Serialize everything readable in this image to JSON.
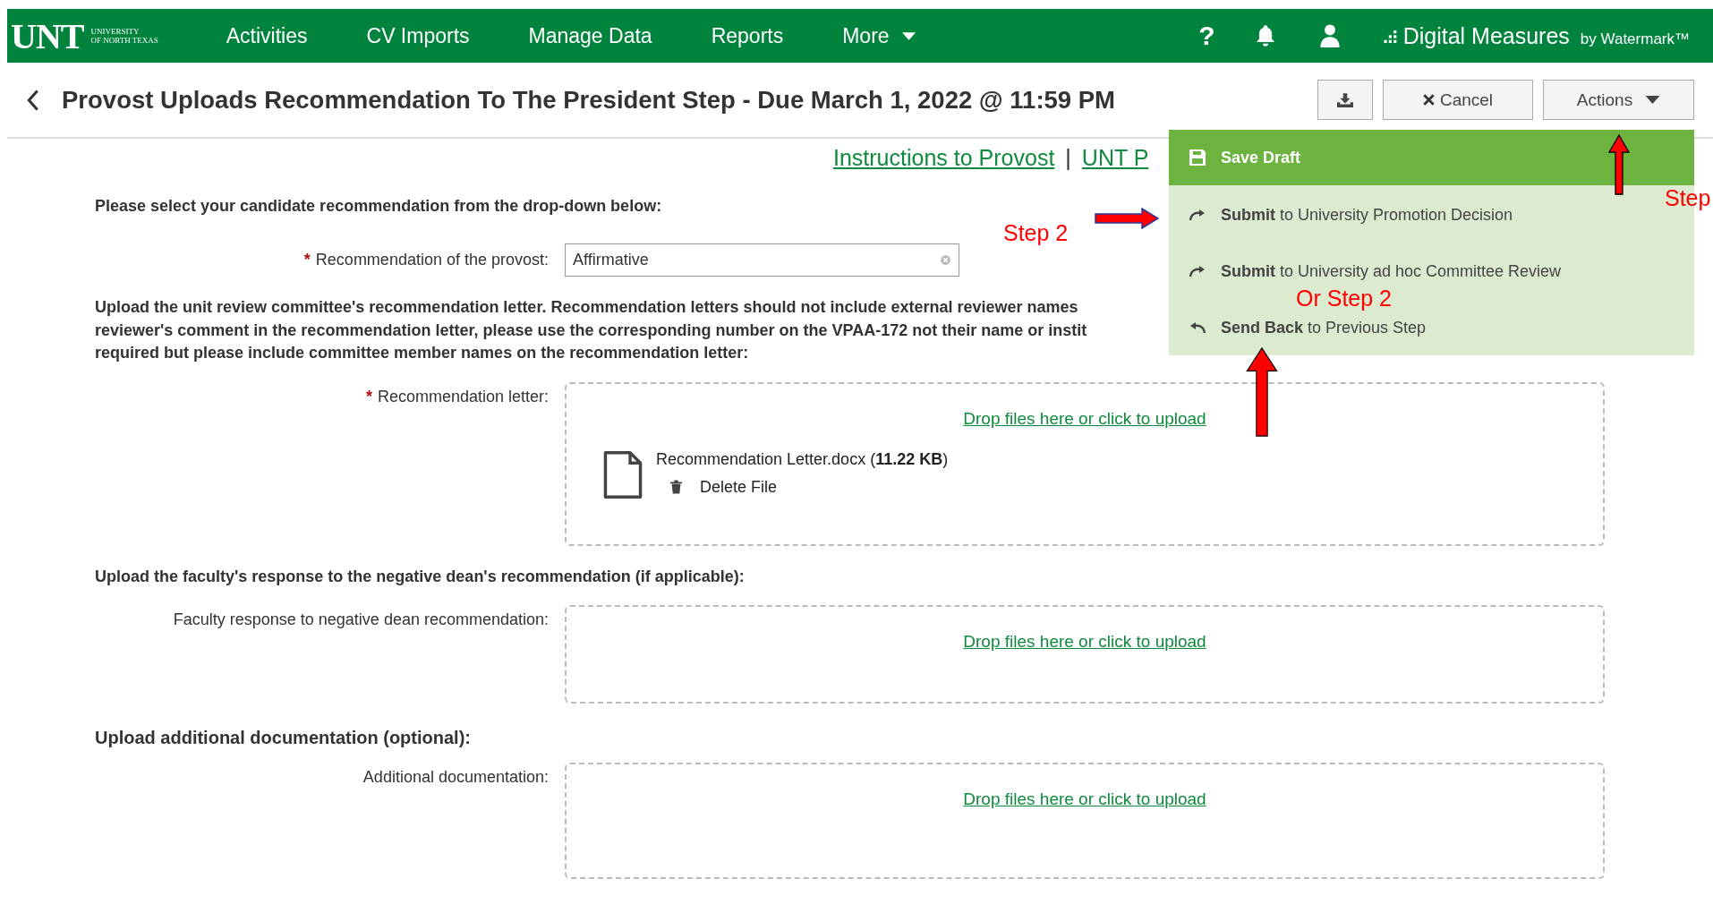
{
  "header": {
    "logo": "UNT",
    "logo_sub": [
      "UNIVERSITY",
      "OF NORTH TEXAS"
    ],
    "nav": [
      {
        "label": "Activities",
        "dropdown": false
      },
      {
        "label": "CV Imports",
        "dropdown": false
      },
      {
        "label": "Manage Data",
        "dropdown": false
      },
      {
        "label": "Reports",
        "dropdown": false
      },
      {
        "label": "More",
        "dropdown": true
      }
    ],
    "help": "?",
    "brand": "Digital Measures",
    "brand_by": "by Watermark™"
  },
  "title": "Provost Uploads Recommendation To The President Step - Due March 1, 2022 @ 11:59 PM",
  "toolbar": {
    "cancel": "Cancel",
    "actions": "Actions"
  },
  "links": [
    "Instructions to Provost",
    "UNT P"
  ],
  "link_separator": "|",
  "actions_menu": [
    {
      "kind": "save",
      "label": "Save Draft",
      "highlighted": true
    },
    {
      "kind": "forward",
      "label": "**Submit** to University Promotion Decision",
      "highlighted": false
    },
    {
      "kind": "forward",
      "label": "**Submit** to University ad hoc Committee Review",
      "highlighted": false
    },
    {
      "kind": "back",
      "label": "**Send Back** to Previous Step",
      "highlighted": false
    }
  ],
  "form": {
    "select_prompt": "Please select your candidate recommendation from the drop-down below:",
    "recommendation_field": {
      "label": "Recommendation of the provost:",
      "required_mark": "*",
      "value": "Affirmative"
    },
    "uploads": [
      {
        "kind": "note",
        "prompt_lines": [
          "Upload the unit review committee's recommendation letter. Recommendation letters should not include external reviewer names",
          "reviewer's comment in the recommendation letter, please use the corresponding number on the VPAA-172 not their name or instit",
          "required but please include committee member names on the recommendation letter:"
        ],
        "label": "Recommendation letter:",
        "required_mark": "*",
        "drop_text": "Drop files here or click to upload",
        "files": [
          {
            "label": "Recommendation Letter.docx (**11.22 KB**)",
            "delete": "Delete File"
          }
        ]
      },
      {
        "kind": "note",
        "prompt_lines": [
          "Upload the faculty's response to the negative dean's recommendation (if applicable):"
        ],
        "label": "Faculty response to negative dean recommendation:",
        "drop_text": "Drop files here or click to upload"
      },
      {
        "kind": "heading",
        "prompt_lines": [
          "Upload additional documentation (optional):"
        ],
        "label": "Additional documentation:",
        "drop_text": "Drop files here or click to upload"
      }
    ]
  },
  "annotations": [
    "Step 2",
    "Step",
    "Or Step 2"
  ]
}
